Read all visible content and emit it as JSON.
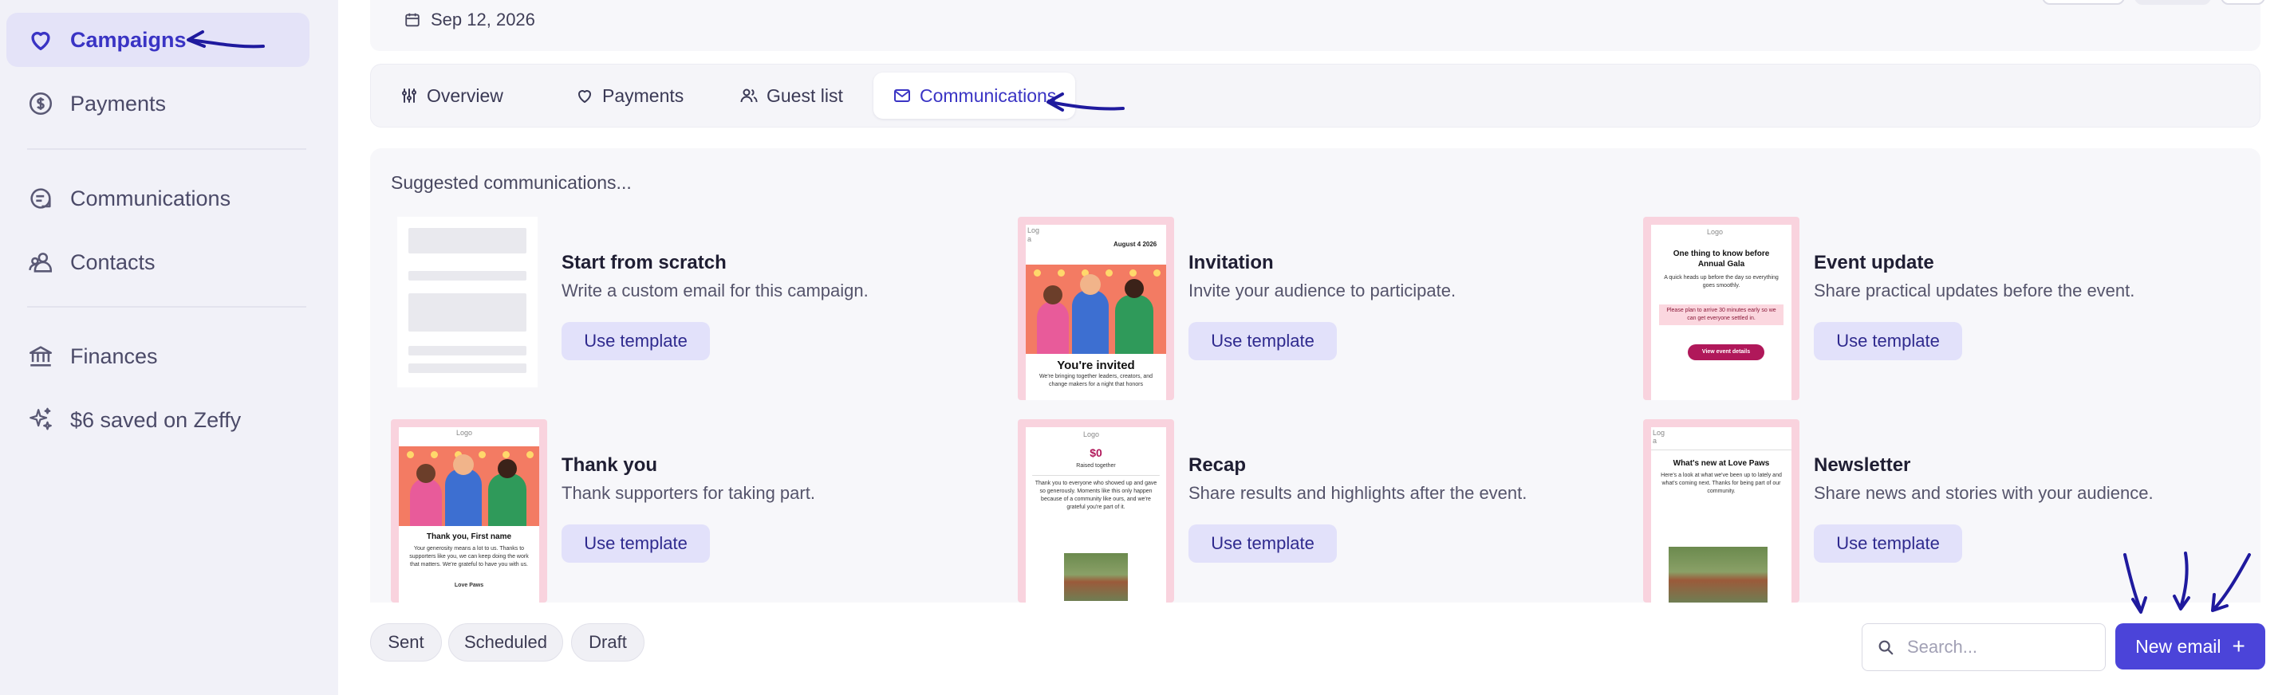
{
  "sidebar": {
    "items": [
      {
        "label": "Campaigns",
        "icon": "heart-icon",
        "active": true
      },
      {
        "label": "Payments",
        "icon": "dollar-circle-icon",
        "active": false
      },
      {
        "label": "Communications",
        "icon": "message-icon",
        "active": false
      },
      {
        "label": "Contacts",
        "icon": "contacts-icon",
        "active": false
      },
      {
        "label": "Finances",
        "icon": "bank-icon",
        "active": false
      },
      {
        "label": "$6 saved on Zeffy",
        "icon": "sparkle-icon",
        "active": false
      }
    ]
  },
  "header": {
    "date": "Sep 12, 2026"
  },
  "tabs": [
    {
      "label": "Overview",
      "icon": "sliders-icon",
      "active": false
    },
    {
      "label": "Payments",
      "icon": "heart-icon",
      "active": false
    },
    {
      "label": "Guest list",
      "icon": "users-icon",
      "active": false
    },
    {
      "label": "Communications",
      "icon": "mail-icon",
      "active": true
    }
  ],
  "suggested": {
    "title": "Suggested communications...",
    "use_label": "Use template",
    "templates": [
      {
        "title": "Start from scratch",
        "desc": "Write a custom email for this campaign."
      },
      {
        "title": "Invitation",
        "desc": "Invite your audience to participate."
      },
      {
        "title": "Event update",
        "desc": "Share practical updates before the event."
      },
      {
        "title": "Thank you",
        "desc": "Thank supporters for taking part."
      },
      {
        "title": "Recap",
        "desc": "Share results and highlights after the event."
      },
      {
        "title": "Newsletter",
        "desc": "Share news and stories with your audience."
      }
    ]
  },
  "previews": {
    "logo": "Logo",
    "logo_short": "Log",
    "logo_a": "a",
    "invite_date": "August 4 2026",
    "invite_heading": "You're invited",
    "invite_text": "We're bringing together leaders, creators, and change makers for a night that honors",
    "update_heading": "One thing to know before Annual Gala",
    "update_text": "A quick heads up before the day so everything goes smoothly.",
    "update_note": "Please plan to arrive 30 minutes early so we can get everyone settled in.",
    "update_button": "View event details",
    "thanks_heading": "Thank you, First name",
    "thanks_text": "Your generosity means a lot to us. Thanks to supporters like you, we can keep doing the work that matters. We're grateful to have you with us.",
    "thanks_sign": "Love Paws",
    "recap_amount": "$0",
    "recap_sub": "Raised together",
    "recap_text": "Thank you to everyone who showed up and gave so generously. Moments like this only happen because of a community like ours, and we're grateful you're part of it.",
    "news_heading": "What's new at Love Paws",
    "news_text": "Here's a look at what we've been up to lately and what's coming next. Thanks for being part of our community."
  },
  "filters": [
    "Sent",
    "Scheduled",
    "Draft"
  ],
  "search": {
    "placeholder": "Search..."
  },
  "new_email": {
    "label": "New email",
    "icon": "plus-icon"
  },
  "colors": {
    "accent": "#4b44d9",
    "active_text": "#3a34c4",
    "annotation_arrow": "#1f1a9e"
  }
}
